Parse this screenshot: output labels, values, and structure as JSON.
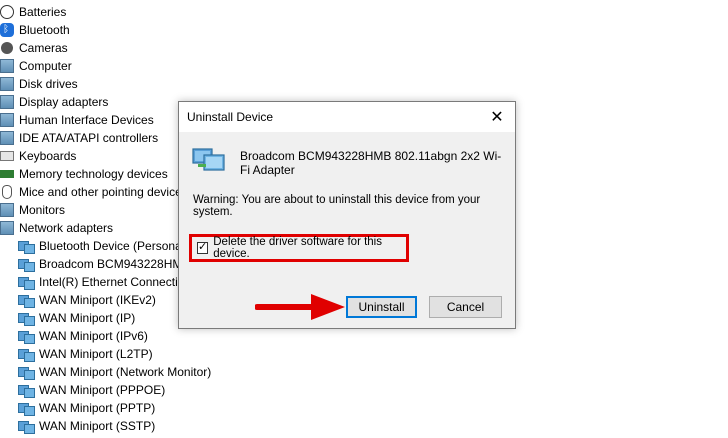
{
  "device_manager": {
    "categories": [
      {
        "label": "Batteries",
        "icon": "battery-icon"
      },
      {
        "label": "Bluetooth",
        "icon": "bluetooth-icon"
      },
      {
        "label": "Cameras",
        "icon": "camera-icon"
      },
      {
        "label": "Computer",
        "icon": "computer-icon"
      },
      {
        "label": "Disk drives",
        "icon": "disk-drive-icon"
      },
      {
        "label": "Display adapters",
        "icon": "display-adapter-icon"
      },
      {
        "label": "Human Interface Devices",
        "icon": "hid-icon"
      },
      {
        "label": "IDE ATA/ATAPI controllers",
        "icon": "ide-controller-icon"
      },
      {
        "label": "Keyboards",
        "icon": "keyboard-icon"
      },
      {
        "label": "Memory technology devices",
        "icon": "memory-icon"
      },
      {
        "label": "Mice and other pointing device",
        "icon": "mouse-icon"
      },
      {
        "label": "Monitors",
        "icon": "monitor-icon"
      },
      {
        "label": "Network adapters",
        "icon": "network-adapter-icon"
      }
    ],
    "network_adapters": [
      "Bluetooth Device (Personal",
      "Broadcom BCM943228HM",
      "Intel(R) Ethernet Connectio",
      "WAN Miniport (IKEv2)",
      "WAN Miniport (IP)",
      "WAN Miniport (IPv6)",
      "WAN Miniport (L2TP)",
      "WAN Miniport (Network Monitor)",
      "WAN Miniport (PPPOE)",
      "WAN Miniport (PPTP)",
      "WAN Miniport (SSTP)"
    ]
  },
  "dialog": {
    "title": "Uninstall Device",
    "close_glyph": "✕",
    "device_name": "Broadcom BCM943228HMB 802.11abgn 2x2 Wi-Fi Adapter",
    "warning": "Warning: You are about to uninstall this device from your system.",
    "checkbox_label": "Delete the driver software for this device.",
    "checkbox_checked": true,
    "uninstall_label": "Uninstall",
    "cancel_label": "Cancel",
    "highlight_color": "#e00000",
    "accent_color": "#0078d7"
  }
}
